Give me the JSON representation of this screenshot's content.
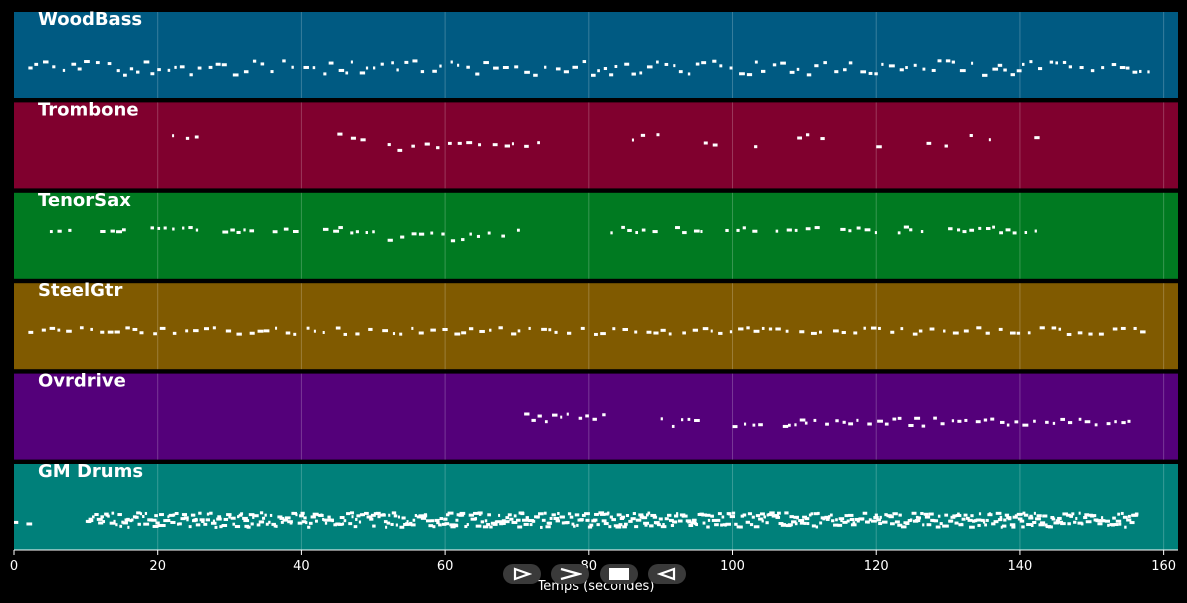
{
  "chart_data": {
    "type": "piano-roll",
    "xlabel": "Temps (secondes)",
    "xlim": [
      0,
      162
    ],
    "xticks": [
      0,
      20,
      40,
      60,
      80,
      100,
      120,
      140,
      160
    ],
    "grid": true,
    "tracks": [
      {
        "name": "WoodBass",
        "color": "#005a82"
      },
      {
        "name": "Trombone",
        "color": "#80002e"
      },
      {
        "name": "TenorSax",
        "color": "#007a21"
      },
      {
        "name": "SteelGtr",
        "color": "#805a00"
      },
      {
        "name": "Ovrdrive",
        "color": "#54007a"
      },
      {
        "name": "GM Drums",
        "color": "#00807a"
      }
    ]
  },
  "controls": [
    {
      "name": "play-icon"
    },
    {
      "name": "fast-forward-icon"
    },
    {
      "name": "stop-icon"
    },
    {
      "name": "rewind-icon"
    }
  ]
}
